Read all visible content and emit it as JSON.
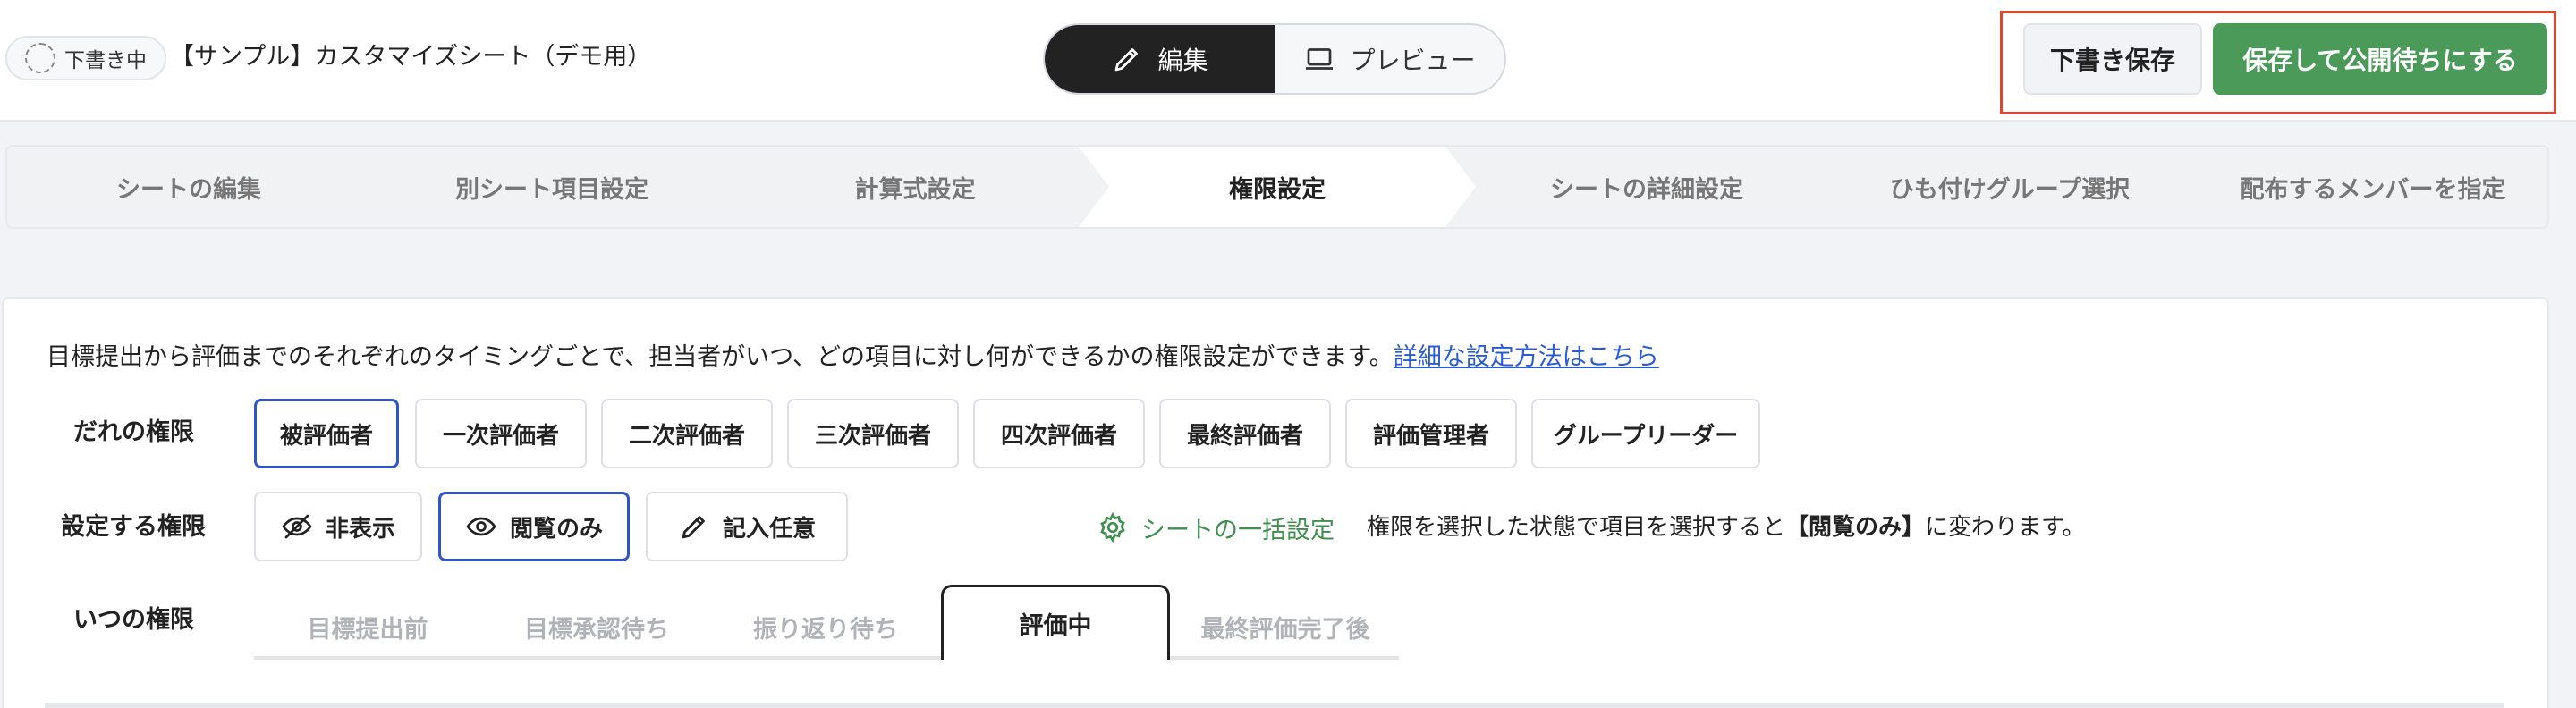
{
  "header": {
    "draft_badge": "下書き中",
    "sheet_title": "【サンプル】カスタマイズシート（デモ用）",
    "mode_edit": "編集",
    "mode_preview": "プレビュー",
    "save_draft": "下書き保存",
    "save_publish": "保存して公開待ちにする"
  },
  "steps": [
    {
      "label": "シートの編集"
    },
    {
      "label": "別シート項目設定"
    },
    {
      "label": "計算式設定"
    },
    {
      "label": "権限設定",
      "active": true
    },
    {
      "label": "シートの詳細設定"
    },
    {
      "label": "ひも付けグループ選択"
    },
    {
      "label": "配布するメンバーを指定"
    }
  ],
  "main": {
    "description": "目標提出から評価までのそれぞれのタイミングごとで、担当者がいつ、どの項目に対し何ができるかの権限設定ができます。",
    "description_link": "詳細な設定方法はこちら",
    "who_label": "だれの権限",
    "who_options": [
      "被評価者",
      "一次評価者",
      "二次評価者",
      "三次評価者",
      "四次評価者",
      "最終評価者",
      "評価管理者",
      "グループリーダー"
    ],
    "who_selected": "被評価者",
    "perm_label": "設定する権限",
    "perm_options": [
      "非表示",
      "閲覧のみ",
      "記入任意"
    ],
    "perm_selected": "閲覧のみ",
    "bulk_setting": "シートの一括設定",
    "hint_pre": "権限を選択した状態で項目を選択すると",
    "hint_bold": "【閲覧のみ】",
    "hint_post": "に変わります。",
    "when_label": "いつの権限",
    "when_tabs": [
      "目標提出前",
      "目標承認待ち",
      "振り返り待ち",
      "評価中",
      "最終評価完了後"
    ],
    "when_selected": "評価中"
  },
  "colors": {
    "accent_blue": "#2f55c9",
    "publish_green": "#4b9a5a",
    "highlight_red": "#e0452f",
    "link_blue": "#2a5bd7"
  }
}
